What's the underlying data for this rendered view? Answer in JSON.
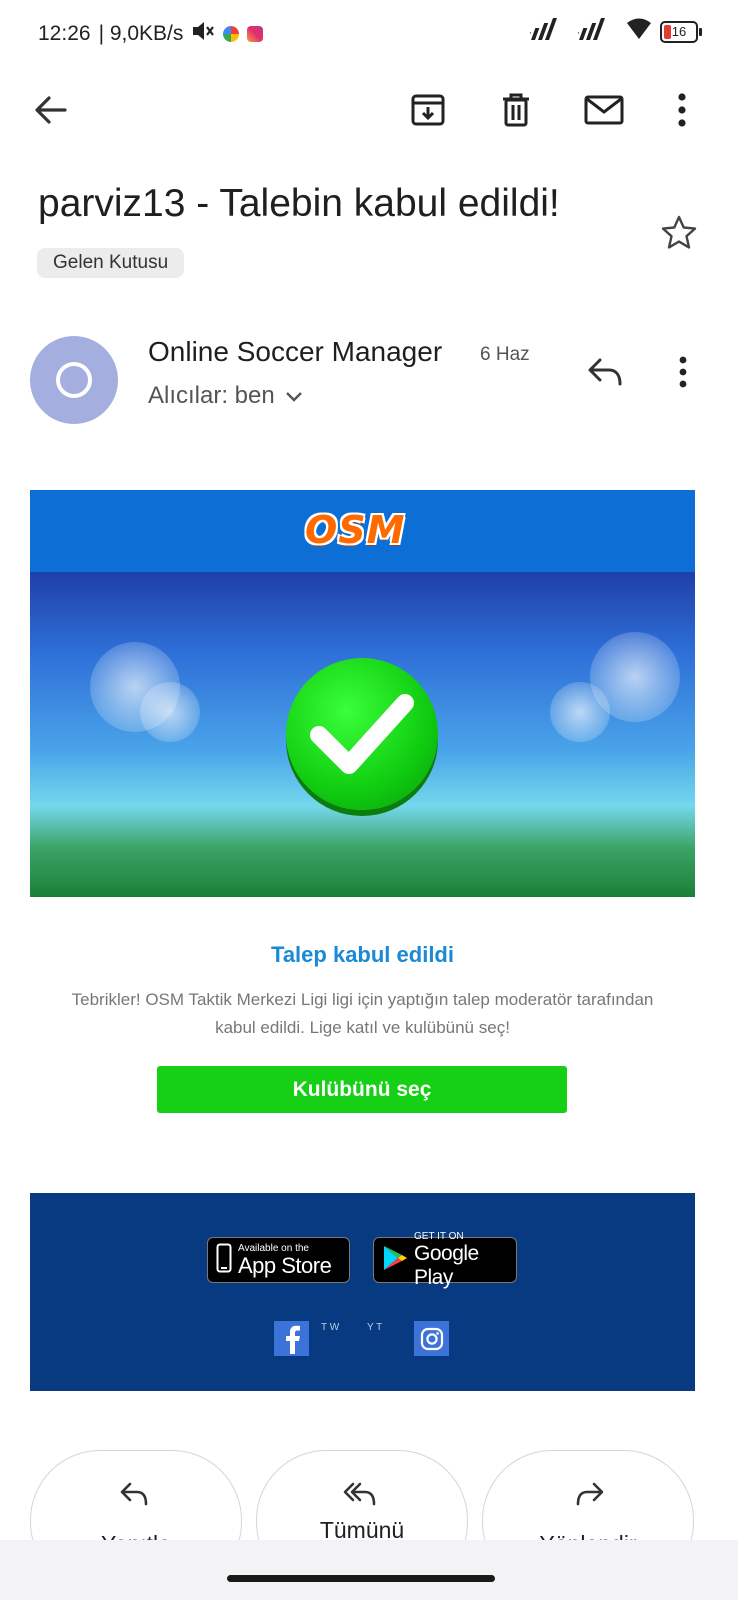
{
  "status_bar": {
    "time": "12:26",
    "speed": "| 9,0KB/s",
    "battery": "16",
    "icons": [
      "mute-icon",
      "app-icon",
      "instagram-icon",
      "signal-icon",
      "signal-icon",
      "wifi-icon",
      "battery-icon"
    ]
  },
  "toolbar": {
    "icons": [
      "back-arrow-icon",
      "archive-icon",
      "trash-icon",
      "mark-unread-icon",
      "more-vert-icon"
    ]
  },
  "email": {
    "subject": "parviz13 - Talebin kabul edildi!",
    "label": "Gelen Kutusu",
    "sender_name": "Online Soccer Manager",
    "date": "6 Haz",
    "recipients": "Alıcılar: ben"
  },
  "content": {
    "logo": "OSM",
    "title": "Talep kabul edildi",
    "body": "Tebrikler! OSM Taktik Merkezi Ligi ligi için yaptığın talep moderatör tarafından kabul edildi. Lige katıl ve kulübünü seç!",
    "cta": "Kulübünü seç",
    "app_store_small": "Available on the",
    "app_store_big": "App Store",
    "google_play_small": "GET IT ON",
    "google_play_big": "Google Play",
    "broken_tw": "T W",
    "broken_yt": "Y T"
  },
  "actions": {
    "reply": "Yanıtla",
    "reply_all": "Tümünü",
    "forward": "Yönlendir"
  },
  "colors": {
    "accent_blue": "#1a8ad6",
    "cta_green": "#15d015",
    "footer_blue": "#083a82",
    "avatar": "#a4aedf"
  }
}
